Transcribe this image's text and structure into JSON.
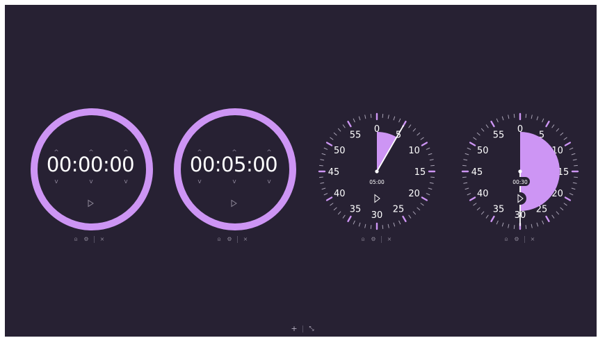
{
  "colors": {
    "background": "#272133",
    "accent": "#cd95f4",
    "text": "#ffffff",
    "muted": "#8d8797"
  },
  "timers": [
    {
      "type": "digital",
      "time": "00:00:00"
    },
    {
      "type": "digital",
      "time": "00:05:00"
    },
    {
      "type": "analog",
      "time": "05:00",
      "remaining_minutes": 5
    },
    {
      "type": "analog",
      "time": "00:30",
      "remaining_minutes": 30
    }
  ],
  "dial_labels": [
    "0",
    "5",
    "10",
    "15",
    "20",
    "25",
    "30",
    "35",
    "40",
    "45",
    "50",
    "55"
  ],
  "icons": {
    "play": "play-icon",
    "bell": "bell-icon",
    "settings": "gear-icon",
    "close": "close-icon",
    "add": "plus-icon",
    "layout": "collapse-icon"
  },
  "glyphs": {
    "up": "^",
    "down": "v",
    "bell": "⍝",
    "gear": "⚙",
    "close": "×",
    "plus": "+",
    "collapse": "⤡"
  }
}
